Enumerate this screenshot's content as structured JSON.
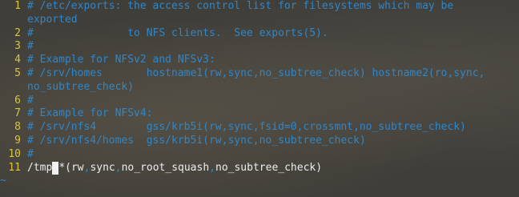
{
  "lines": [
    {
      "num": "1",
      "text": "# /etc/exports: the access control list for filesystems which may be"
    },
    {
      "num": "",
      "text": "exported"
    },
    {
      "num": "2",
      "text": "#               to NFS clients.  See exports(5)."
    },
    {
      "num": "3",
      "text": "#"
    },
    {
      "num": "4",
      "text": "# Example for NFSv2 and NFSv3:"
    },
    {
      "num": "5",
      "text": "# /srv/homes       hostname1(rw,sync,no_subtree_check) hostname2(ro,sync,"
    },
    {
      "num": "",
      "text": "no_subtree_check)"
    },
    {
      "num": "6",
      "text": "#"
    },
    {
      "num": "7",
      "text": "# Example for NFSv4:"
    },
    {
      "num": "8",
      "text": "# /srv/nfs4        gss/krb5i(rw,sync,fsid=0,crossmnt,no_subtree_check)"
    },
    {
      "num": "9",
      "text": "# /srv/nfs4/homes  gss/krb5i(rw,sync,no_subtree_check)"
    },
    {
      "num": "10",
      "text": "#"
    }
  ],
  "current_line": {
    "num": "11",
    "before_cursor": "/tmp",
    "cursor_char": " ",
    "after_cursor": "*(rw",
    "sep1": ",",
    "part2": "sync",
    "sep2": ",",
    "part3": "no_root_squash",
    "sep3": ",",
    "part4": "no_subtree_check)"
  },
  "tilde": "~",
  "colors": {
    "comment": "#2f86c9",
    "line_number": "#d9c53b",
    "text": "#ececec"
  }
}
